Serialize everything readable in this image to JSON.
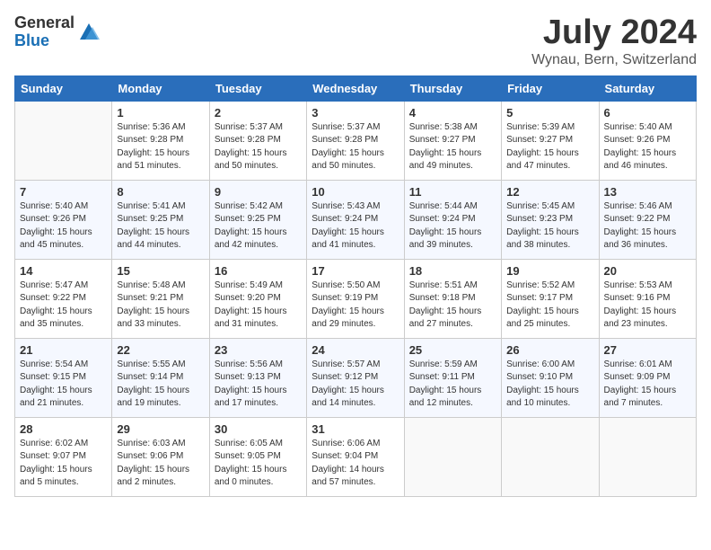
{
  "header": {
    "logo_general": "General",
    "logo_blue": "Blue",
    "month_year": "July 2024",
    "location": "Wynau, Bern, Switzerland"
  },
  "days_of_week": [
    "Sunday",
    "Monday",
    "Tuesday",
    "Wednesday",
    "Thursday",
    "Friday",
    "Saturday"
  ],
  "weeks": [
    [
      {
        "day": "",
        "info": ""
      },
      {
        "day": "1",
        "info": "Sunrise: 5:36 AM\nSunset: 9:28 PM\nDaylight: 15 hours\nand 51 minutes."
      },
      {
        "day": "2",
        "info": "Sunrise: 5:37 AM\nSunset: 9:28 PM\nDaylight: 15 hours\nand 50 minutes."
      },
      {
        "day": "3",
        "info": "Sunrise: 5:37 AM\nSunset: 9:28 PM\nDaylight: 15 hours\nand 50 minutes."
      },
      {
        "day": "4",
        "info": "Sunrise: 5:38 AM\nSunset: 9:27 PM\nDaylight: 15 hours\nand 49 minutes."
      },
      {
        "day": "5",
        "info": "Sunrise: 5:39 AM\nSunset: 9:27 PM\nDaylight: 15 hours\nand 47 minutes."
      },
      {
        "day": "6",
        "info": "Sunrise: 5:40 AM\nSunset: 9:26 PM\nDaylight: 15 hours\nand 46 minutes."
      }
    ],
    [
      {
        "day": "7",
        "info": "Sunrise: 5:40 AM\nSunset: 9:26 PM\nDaylight: 15 hours\nand 45 minutes."
      },
      {
        "day": "8",
        "info": "Sunrise: 5:41 AM\nSunset: 9:25 PM\nDaylight: 15 hours\nand 44 minutes."
      },
      {
        "day": "9",
        "info": "Sunrise: 5:42 AM\nSunset: 9:25 PM\nDaylight: 15 hours\nand 42 minutes."
      },
      {
        "day": "10",
        "info": "Sunrise: 5:43 AM\nSunset: 9:24 PM\nDaylight: 15 hours\nand 41 minutes."
      },
      {
        "day": "11",
        "info": "Sunrise: 5:44 AM\nSunset: 9:24 PM\nDaylight: 15 hours\nand 39 minutes."
      },
      {
        "day": "12",
        "info": "Sunrise: 5:45 AM\nSunset: 9:23 PM\nDaylight: 15 hours\nand 38 minutes."
      },
      {
        "day": "13",
        "info": "Sunrise: 5:46 AM\nSunset: 9:22 PM\nDaylight: 15 hours\nand 36 minutes."
      }
    ],
    [
      {
        "day": "14",
        "info": "Sunrise: 5:47 AM\nSunset: 9:22 PM\nDaylight: 15 hours\nand 35 minutes."
      },
      {
        "day": "15",
        "info": "Sunrise: 5:48 AM\nSunset: 9:21 PM\nDaylight: 15 hours\nand 33 minutes."
      },
      {
        "day": "16",
        "info": "Sunrise: 5:49 AM\nSunset: 9:20 PM\nDaylight: 15 hours\nand 31 minutes."
      },
      {
        "day": "17",
        "info": "Sunrise: 5:50 AM\nSunset: 9:19 PM\nDaylight: 15 hours\nand 29 minutes."
      },
      {
        "day": "18",
        "info": "Sunrise: 5:51 AM\nSunset: 9:18 PM\nDaylight: 15 hours\nand 27 minutes."
      },
      {
        "day": "19",
        "info": "Sunrise: 5:52 AM\nSunset: 9:17 PM\nDaylight: 15 hours\nand 25 minutes."
      },
      {
        "day": "20",
        "info": "Sunrise: 5:53 AM\nSunset: 9:16 PM\nDaylight: 15 hours\nand 23 minutes."
      }
    ],
    [
      {
        "day": "21",
        "info": "Sunrise: 5:54 AM\nSunset: 9:15 PM\nDaylight: 15 hours\nand 21 minutes."
      },
      {
        "day": "22",
        "info": "Sunrise: 5:55 AM\nSunset: 9:14 PM\nDaylight: 15 hours\nand 19 minutes."
      },
      {
        "day": "23",
        "info": "Sunrise: 5:56 AM\nSunset: 9:13 PM\nDaylight: 15 hours\nand 17 minutes."
      },
      {
        "day": "24",
        "info": "Sunrise: 5:57 AM\nSunset: 9:12 PM\nDaylight: 15 hours\nand 14 minutes."
      },
      {
        "day": "25",
        "info": "Sunrise: 5:59 AM\nSunset: 9:11 PM\nDaylight: 15 hours\nand 12 minutes."
      },
      {
        "day": "26",
        "info": "Sunrise: 6:00 AM\nSunset: 9:10 PM\nDaylight: 15 hours\nand 10 minutes."
      },
      {
        "day": "27",
        "info": "Sunrise: 6:01 AM\nSunset: 9:09 PM\nDaylight: 15 hours\nand 7 minutes."
      }
    ],
    [
      {
        "day": "28",
        "info": "Sunrise: 6:02 AM\nSunset: 9:07 PM\nDaylight: 15 hours\nand 5 minutes."
      },
      {
        "day": "29",
        "info": "Sunrise: 6:03 AM\nSunset: 9:06 PM\nDaylight: 15 hours\nand 2 minutes."
      },
      {
        "day": "30",
        "info": "Sunrise: 6:05 AM\nSunset: 9:05 PM\nDaylight: 15 hours\nand 0 minutes."
      },
      {
        "day": "31",
        "info": "Sunrise: 6:06 AM\nSunset: 9:04 PM\nDaylight: 14 hours\nand 57 minutes."
      },
      {
        "day": "",
        "info": ""
      },
      {
        "day": "",
        "info": ""
      },
      {
        "day": "",
        "info": ""
      }
    ]
  ]
}
